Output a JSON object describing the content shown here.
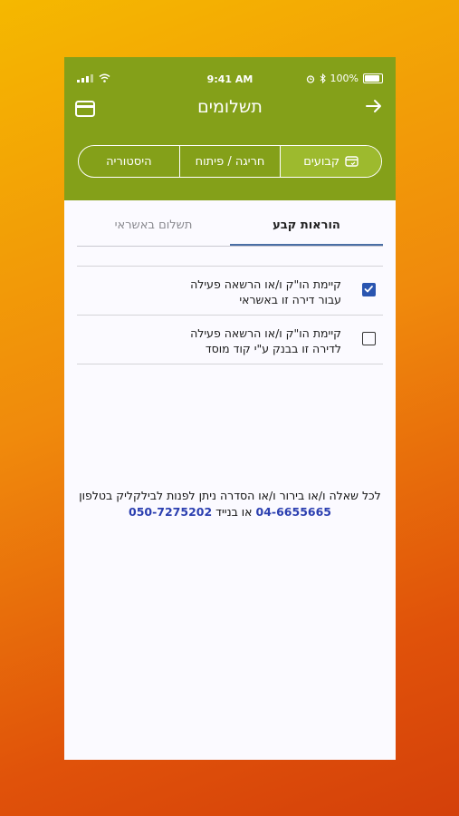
{
  "status_bar": {
    "time": "9:41 AM",
    "battery": "100%"
  },
  "header": {
    "title": "תשלומים"
  },
  "segments": [
    {
      "label": "קבועים",
      "active": true
    },
    {
      "label": "חריגה / פיתוח",
      "active": false
    },
    {
      "label": "היסטוריה",
      "active": false
    }
  ],
  "tabs": [
    {
      "label": "הוראות קבע",
      "active": true
    },
    {
      "label": "תשלום באשראי",
      "active": false
    }
  ],
  "options": [
    {
      "line1": "קיימת הו\"ק ו/או הרשאה פעילה",
      "line2": "עבור דירה זו באשראי",
      "checked": true
    },
    {
      "line1": "קיימת הו\"ק ו/או הרשאה פעילה",
      "line2": "לדירה זו בבנק ע\"י קוד מוסד",
      "checked": false
    }
  ],
  "footer": {
    "line1": "לכל שאלה ו/או בירור ו/או הסדרה ניתן לפנות לבילקליק בטלפון",
    "phone1": "04-6655665",
    "connector": "או בנייד",
    "phone2": "050-7275202"
  },
  "colors": {
    "header_bg": "#84a019",
    "checkbox_checked": "#2a55b0",
    "phone_link": "#2b3fb0",
    "tab_underline": "#4a6fa5"
  }
}
